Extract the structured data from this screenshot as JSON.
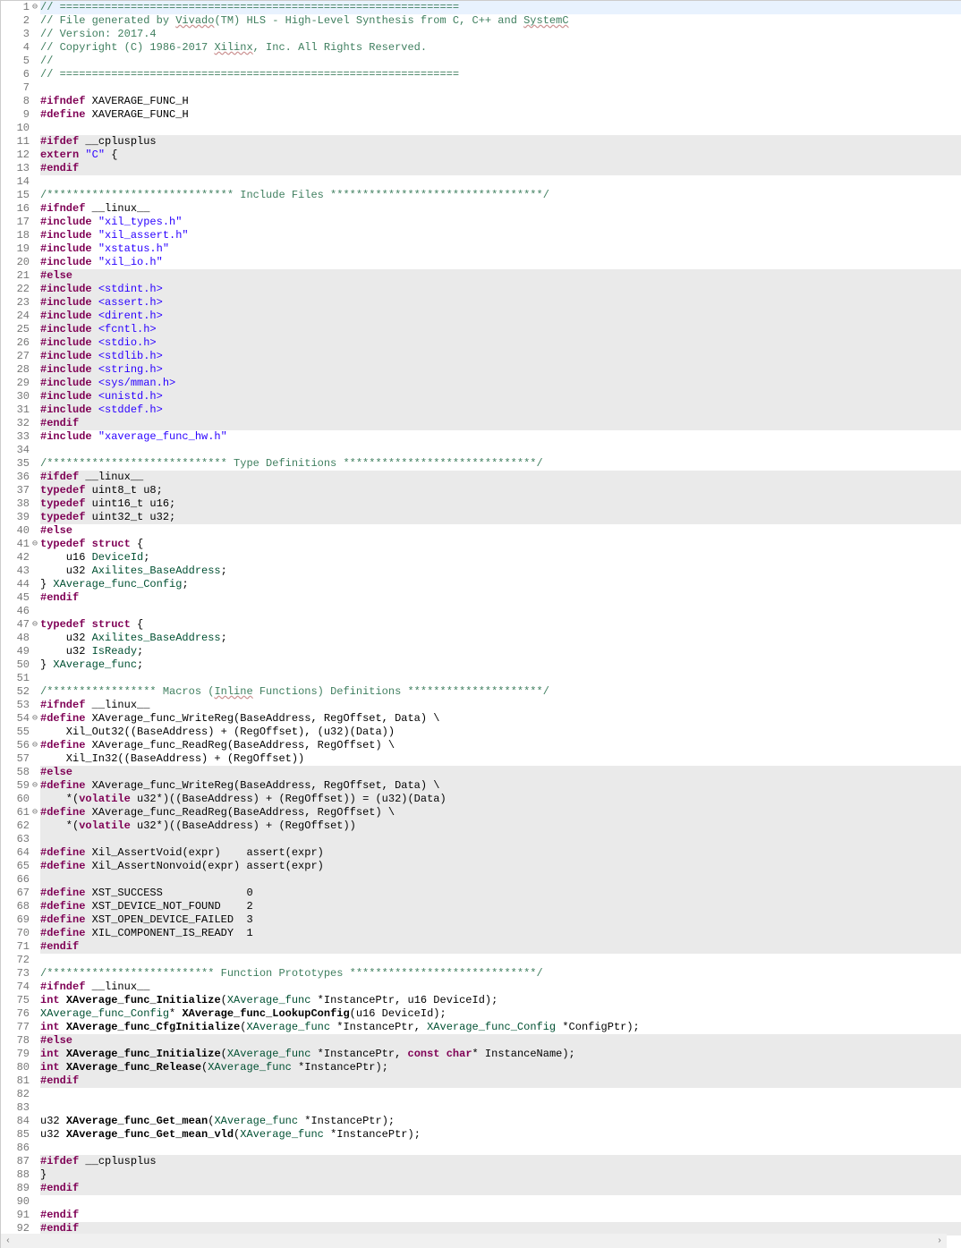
{
  "lines": [
    {
      "n": 1,
      "fold": "⊖",
      "bg": "cursor",
      "tokens": [
        [
          "comment",
          "// =============================================================="
        ]
      ]
    },
    {
      "n": 2,
      "tokens": [
        [
          "comment",
          "// File generated by "
        ],
        [
          "comment uw",
          "Vivado"
        ],
        [
          "comment",
          "(TM) HLS - High-Level Synthesis from C, C++ and "
        ],
        [
          "comment uw",
          "SystemC"
        ]
      ]
    },
    {
      "n": 3,
      "tokens": [
        [
          "comment",
          "// Version: 2017.4"
        ]
      ]
    },
    {
      "n": 4,
      "tokens": [
        [
          "comment",
          "// Copyright (C) 1986-2017 "
        ],
        [
          "comment uw",
          "Xilinx"
        ],
        [
          "comment",
          ", Inc. All Rights Reserved."
        ]
      ]
    },
    {
      "n": 5,
      "tokens": [
        [
          "comment",
          "// "
        ]
      ]
    },
    {
      "n": 6,
      "tokens": [
        [
          "comment",
          "// =============================================================="
        ]
      ]
    },
    {
      "n": 7,
      "tokens": [
        [
          "",
          ""
        ]
      ]
    },
    {
      "n": 8,
      "tokens": [
        [
          "pp",
          "#ifndef"
        ],
        [
          "",
          " XAVERAGE_FUNC_H"
        ]
      ]
    },
    {
      "n": 9,
      "tokens": [
        [
          "pp",
          "#define"
        ],
        [
          "",
          " XAVERAGE_FUNC_H"
        ]
      ]
    },
    {
      "n": 10,
      "tokens": [
        [
          "",
          ""
        ]
      ]
    },
    {
      "n": 11,
      "bg": "gray",
      "tokens": [
        [
          "pp",
          "#ifdef"
        ],
        [
          "",
          " __cplusplus"
        ]
      ]
    },
    {
      "n": 12,
      "bg": "gray",
      "tokens": [
        [
          "kw",
          "extern"
        ],
        [
          "",
          " "
        ],
        [
          "str",
          "\"C\""
        ],
        [
          "",
          " {"
        ]
      ]
    },
    {
      "n": 13,
      "bg": "gray",
      "tokens": [
        [
          "pp",
          "#endif"
        ]
      ]
    },
    {
      "n": 14,
      "tokens": [
        [
          "",
          ""
        ]
      ]
    },
    {
      "n": 15,
      "tokens": [
        [
          "comment",
          "/***************************** Include Files *********************************/"
        ]
      ]
    },
    {
      "n": 16,
      "tokens": [
        [
          "pp",
          "#ifndef"
        ],
        [
          "",
          " __linux__"
        ]
      ]
    },
    {
      "n": 17,
      "tokens": [
        [
          "pp",
          "#include"
        ],
        [
          "",
          " "
        ],
        [
          "str",
          "\"xil_types.h\""
        ]
      ]
    },
    {
      "n": 18,
      "tokens": [
        [
          "pp",
          "#include"
        ],
        [
          "",
          " "
        ],
        [
          "str",
          "\"xil_assert.h\""
        ]
      ]
    },
    {
      "n": 19,
      "tokens": [
        [
          "pp",
          "#include"
        ],
        [
          "",
          " "
        ],
        [
          "str",
          "\"xstatus.h\""
        ]
      ]
    },
    {
      "n": 20,
      "tokens": [
        [
          "pp",
          "#include"
        ],
        [
          "",
          " "
        ],
        [
          "str",
          "\"xil_io.h\""
        ]
      ]
    },
    {
      "n": 21,
      "bg": "gray",
      "tokens": [
        [
          "pp",
          "#else"
        ]
      ]
    },
    {
      "n": 22,
      "bg": "gray",
      "tokens": [
        [
          "pp",
          "#include"
        ],
        [
          "",
          " "
        ],
        [
          "str",
          "<stdint.h>"
        ]
      ]
    },
    {
      "n": 23,
      "bg": "gray",
      "tokens": [
        [
          "pp",
          "#include"
        ],
        [
          "",
          " "
        ],
        [
          "str",
          "<assert.h>"
        ]
      ]
    },
    {
      "n": 24,
      "bg": "gray",
      "tokens": [
        [
          "pp",
          "#include"
        ],
        [
          "",
          " "
        ],
        [
          "str",
          "<dirent.h>"
        ]
      ]
    },
    {
      "n": 25,
      "bg": "gray",
      "tokens": [
        [
          "pp",
          "#include"
        ],
        [
          "",
          " "
        ],
        [
          "str",
          "<fcntl.h>"
        ]
      ]
    },
    {
      "n": 26,
      "bg": "gray",
      "tokens": [
        [
          "pp",
          "#include"
        ],
        [
          "",
          " "
        ],
        [
          "str",
          "<stdio.h>"
        ]
      ]
    },
    {
      "n": 27,
      "bg": "gray",
      "tokens": [
        [
          "pp",
          "#include"
        ],
        [
          "",
          " "
        ],
        [
          "str",
          "<stdlib.h>"
        ]
      ]
    },
    {
      "n": 28,
      "bg": "gray",
      "tokens": [
        [
          "pp",
          "#include"
        ],
        [
          "",
          " "
        ],
        [
          "str",
          "<string.h>"
        ]
      ]
    },
    {
      "n": 29,
      "bg": "gray",
      "tokens": [
        [
          "pp",
          "#include"
        ],
        [
          "",
          " "
        ],
        [
          "str",
          "<sys/mman.h>"
        ]
      ]
    },
    {
      "n": 30,
      "bg": "gray",
      "tokens": [
        [
          "pp",
          "#include"
        ],
        [
          "",
          " "
        ],
        [
          "str",
          "<unistd.h>"
        ]
      ]
    },
    {
      "n": 31,
      "bg": "gray",
      "tokens": [
        [
          "pp",
          "#include"
        ],
        [
          "",
          " "
        ],
        [
          "str",
          "<stddef.h>"
        ]
      ]
    },
    {
      "n": 32,
      "bg": "gray",
      "tokens": [
        [
          "pp",
          "#endif"
        ]
      ]
    },
    {
      "n": 33,
      "tokens": [
        [
          "pp",
          "#include"
        ],
        [
          "",
          " "
        ],
        [
          "str",
          "\"xaverage_func_hw.h\""
        ]
      ]
    },
    {
      "n": 34,
      "tokens": [
        [
          "",
          ""
        ]
      ]
    },
    {
      "n": 35,
      "tokens": [
        [
          "comment",
          "/**************************** Type Definitions ******************************/"
        ]
      ]
    },
    {
      "n": 36,
      "bg": "gray",
      "tokens": [
        [
          "pp",
          "#ifdef"
        ],
        [
          "",
          " __linux__"
        ]
      ]
    },
    {
      "n": 37,
      "bg": "gray",
      "tokens": [
        [
          "kw",
          "typedef"
        ],
        [
          "",
          " uint8_t u8;"
        ]
      ]
    },
    {
      "n": 38,
      "bg": "gray",
      "tokens": [
        [
          "kw",
          "typedef"
        ],
        [
          "",
          " uint16_t u16;"
        ]
      ]
    },
    {
      "n": 39,
      "bg": "gray",
      "tokens": [
        [
          "kw",
          "typedef"
        ],
        [
          "",
          " uint32_t u32;"
        ]
      ]
    },
    {
      "n": 40,
      "tokens": [
        [
          "pp",
          "#else"
        ]
      ]
    },
    {
      "n": 41,
      "fold": "⊖",
      "tokens": [
        [
          "kw",
          "typedef"
        ],
        [
          "",
          " "
        ],
        [
          "kw",
          "struct"
        ],
        [
          "",
          " {"
        ]
      ]
    },
    {
      "n": 42,
      "tokens": [
        [
          "",
          "    u16 "
        ],
        [
          "type",
          "DeviceId"
        ],
        [
          "",
          ";"
        ]
      ]
    },
    {
      "n": 43,
      "tokens": [
        [
          "",
          "    u32 "
        ],
        [
          "type",
          "Axilites_BaseAddress"
        ],
        [
          "",
          ";"
        ]
      ]
    },
    {
      "n": 44,
      "tokens": [
        [
          "",
          "} "
        ],
        [
          "type",
          "XAverage_func_Config"
        ],
        [
          "",
          ";"
        ]
      ]
    },
    {
      "n": 45,
      "tokens": [
        [
          "pp",
          "#endif"
        ]
      ]
    },
    {
      "n": 46,
      "tokens": [
        [
          "",
          ""
        ]
      ]
    },
    {
      "n": 47,
      "fold": "⊖",
      "tokens": [
        [
          "kw",
          "typedef"
        ],
        [
          "",
          " "
        ],
        [
          "kw",
          "struct"
        ],
        [
          "",
          " {"
        ]
      ]
    },
    {
      "n": 48,
      "tokens": [
        [
          "",
          "    u32 "
        ],
        [
          "type",
          "Axilites_BaseAddress"
        ],
        [
          "",
          ";"
        ]
      ]
    },
    {
      "n": 49,
      "tokens": [
        [
          "",
          "    u32 "
        ],
        [
          "type",
          "IsReady"
        ],
        [
          "",
          ";"
        ]
      ]
    },
    {
      "n": 50,
      "tokens": [
        [
          "",
          "} "
        ],
        [
          "type",
          "XAverage_func"
        ],
        [
          "",
          ";"
        ]
      ]
    },
    {
      "n": 51,
      "tokens": [
        [
          "",
          ""
        ]
      ]
    },
    {
      "n": 52,
      "tokens": [
        [
          "comment",
          "/***************** Macros ("
        ],
        [
          "comment uw",
          "Inline"
        ],
        [
          "comment",
          " Functions) Definitions *********************/"
        ]
      ]
    },
    {
      "n": 53,
      "tokens": [
        [
          "pp",
          "#ifndef"
        ],
        [
          "",
          " __linux__"
        ]
      ]
    },
    {
      "n": 54,
      "fold": "⊖",
      "tokens": [
        [
          "pp",
          "#define"
        ],
        [
          "",
          " XAverage_func_WriteReg(BaseAddress, RegOffset, Data) \\"
        ]
      ]
    },
    {
      "n": 55,
      "tokens": [
        [
          "",
          "    Xil_Out32((BaseAddress) + (RegOffset), (u32)(Data))"
        ]
      ]
    },
    {
      "n": 56,
      "fold": "⊖",
      "tokens": [
        [
          "pp",
          "#define"
        ],
        [
          "",
          " XAverage_func_ReadReg(BaseAddress, RegOffset) \\"
        ]
      ]
    },
    {
      "n": 57,
      "tokens": [
        [
          "",
          "    Xil_In32((BaseAddress) + (RegOffset))"
        ]
      ]
    },
    {
      "n": 58,
      "bg": "gray",
      "tokens": [
        [
          "pp",
          "#else"
        ]
      ]
    },
    {
      "n": 59,
      "fold": "⊖",
      "bg": "gray",
      "tokens": [
        [
          "pp",
          "#define"
        ],
        [
          "",
          " XAverage_func_WriteReg(BaseAddress, RegOffset, Data) \\"
        ]
      ]
    },
    {
      "n": 60,
      "bg": "gray",
      "tokens": [
        [
          "",
          "    *("
        ],
        [
          "kw",
          "volatile"
        ],
        [
          "",
          " u32*)((BaseAddress) + (RegOffset)) = (u32)(Data)"
        ]
      ]
    },
    {
      "n": 61,
      "fold": "⊖",
      "bg": "gray",
      "tokens": [
        [
          "pp",
          "#define"
        ],
        [
          "",
          " XAverage_func_ReadReg(BaseAddress, RegOffset) \\"
        ]
      ]
    },
    {
      "n": 62,
      "bg": "gray",
      "tokens": [
        [
          "",
          "    *("
        ],
        [
          "kw",
          "volatile"
        ],
        [
          "",
          " u32*)((BaseAddress) + (RegOffset))"
        ]
      ]
    },
    {
      "n": 63,
      "bg": "gray",
      "tokens": [
        [
          "",
          ""
        ]
      ]
    },
    {
      "n": 64,
      "bg": "gray",
      "tokens": [
        [
          "pp",
          "#define"
        ],
        [
          "",
          " Xil_AssertVoid(expr)    assert(expr)"
        ]
      ]
    },
    {
      "n": 65,
      "bg": "gray",
      "tokens": [
        [
          "pp",
          "#define"
        ],
        [
          "",
          " Xil_AssertNonvoid(expr) assert(expr)"
        ]
      ]
    },
    {
      "n": 66,
      "bg": "gray",
      "tokens": [
        [
          "",
          ""
        ]
      ]
    },
    {
      "n": 67,
      "bg": "gray",
      "tokens": [
        [
          "pp",
          "#define"
        ],
        [
          "",
          " XST_SUCCESS             0"
        ]
      ]
    },
    {
      "n": 68,
      "bg": "gray",
      "tokens": [
        [
          "pp",
          "#define"
        ],
        [
          "",
          " XST_DEVICE_NOT_FOUND    2"
        ]
      ]
    },
    {
      "n": 69,
      "bg": "gray",
      "tokens": [
        [
          "pp",
          "#define"
        ],
        [
          "",
          " XST_OPEN_DEVICE_FAILED  3"
        ]
      ]
    },
    {
      "n": 70,
      "bg": "gray",
      "tokens": [
        [
          "pp",
          "#define"
        ],
        [
          "",
          " XIL_COMPONENT_IS_READY  1"
        ]
      ]
    },
    {
      "n": 71,
      "bg": "gray",
      "tokens": [
        [
          "pp",
          "#endif"
        ]
      ]
    },
    {
      "n": 72,
      "tokens": [
        [
          "",
          ""
        ]
      ]
    },
    {
      "n": 73,
      "tokens": [
        [
          "comment",
          "/************************** Function Prototypes *****************************/"
        ]
      ]
    },
    {
      "n": 74,
      "tokens": [
        [
          "pp",
          "#ifndef"
        ],
        [
          "",
          " __linux__"
        ]
      ]
    },
    {
      "n": 75,
      "tokens": [
        [
          "kw",
          "int"
        ],
        [
          "",
          " "
        ],
        [
          "func",
          "XAverage_func_Initialize"
        ],
        [
          "",
          "("
        ],
        [
          "type",
          "XAverage_func"
        ],
        [
          "",
          " *InstancePtr, u16 DeviceId);"
        ]
      ]
    },
    {
      "n": 76,
      "tokens": [
        [
          "type",
          "XAverage_func_Config"
        ],
        [
          "",
          "* "
        ],
        [
          "func",
          "XAverage_func_LookupConfig"
        ],
        [
          "",
          "(u16 DeviceId);"
        ]
      ]
    },
    {
      "n": 77,
      "tokens": [
        [
          "kw",
          "int"
        ],
        [
          "",
          " "
        ],
        [
          "func",
          "XAverage_func_CfgInitialize"
        ],
        [
          "",
          "("
        ],
        [
          "type",
          "XAverage_func"
        ],
        [
          "",
          " *InstancePtr, "
        ],
        [
          "type",
          "XAverage_func_Config"
        ],
        [
          "",
          " *ConfigPtr);"
        ]
      ]
    },
    {
      "n": 78,
      "bg": "gray",
      "tokens": [
        [
          "pp",
          "#else"
        ]
      ]
    },
    {
      "n": 79,
      "bg": "gray",
      "tokens": [
        [
          "kw",
          "int"
        ],
        [
          "",
          " "
        ],
        [
          "func",
          "XAverage_func_Initialize"
        ],
        [
          "",
          "("
        ],
        [
          "type",
          "XAverage_func"
        ],
        [
          "",
          " *InstancePtr, "
        ],
        [
          "kw",
          "const"
        ],
        [
          "",
          " "
        ],
        [
          "kw",
          "char"
        ],
        [
          "",
          "* InstanceName);"
        ]
      ]
    },
    {
      "n": 80,
      "bg": "gray",
      "tokens": [
        [
          "kw",
          "int"
        ],
        [
          "",
          " "
        ],
        [
          "func",
          "XAverage_func_Release"
        ],
        [
          "",
          "("
        ],
        [
          "type",
          "XAverage_func"
        ],
        [
          "",
          " *InstancePtr);"
        ]
      ]
    },
    {
      "n": 81,
      "bg": "gray",
      "tokens": [
        [
          "pp",
          "#endif"
        ]
      ]
    },
    {
      "n": 82,
      "tokens": [
        [
          "",
          ""
        ]
      ]
    },
    {
      "n": 83,
      "tokens": [
        [
          "",
          ""
        ]
      ]
    },
    {
      "n": 84,
      "tokens": [
        [
          "",
          "u32 "
        ],
        [
          "func",
          "XAverage_func_Get_mean"
        ],
        [
          "",
          "("
        ],
        [
          "type",
          "XAverage_func"
        ],
        [
          "",
          " *InstancePtr);"
        ]
      ]
    },
    {
      "n": 85,
      "tokens": [
        [
          "",
          "u32 "
        ],
        [
          "func",
          "XAverage_func_Get_mean_vld"
        ],
        [
          "",
          "("
        ],
        [
          "type",
          "XAverage_func"
        ],
        [
          "",
          " *InstancePtr);"
        ]
      ]
    },
    {
      "n": 86,
      "tokens": [
        [
          "",
          ""
        ]
      ]
    },
    {
      "n": 87,
      "bg": "gray",
      "tokens": [
        [
          "pp",
          "#ifdef"
        ],
        [
          "",
          " __cplusplus"
        ]
      ]
    },
    {
      "n": 88,
      "bg": "gray",
      "tokens": [
        [
          "",
          "}"
        ]
      ]
    },
    {
      "n": 89,
      "bg": "gray",
      "tokens": [
        [
          "pp",
          "#endif"
        ]
      ]
    },
    {
      "n": 90,
      "tokens": [
        [
          "",
          ""
        ]
      ]
    },
    {
      "n": 91,
      "tokens": [
        [
          "pp",
          "#endif"
        ]
      ]
    },
    {
      "n": 92,
      "bg": "gray",
      "tokens": [
        [
          "pp",
          "#endif"
        ]
      ]
    }
  ],
  "hscroll": {
    "left": "‹",
    "right": "›"
  }
}
